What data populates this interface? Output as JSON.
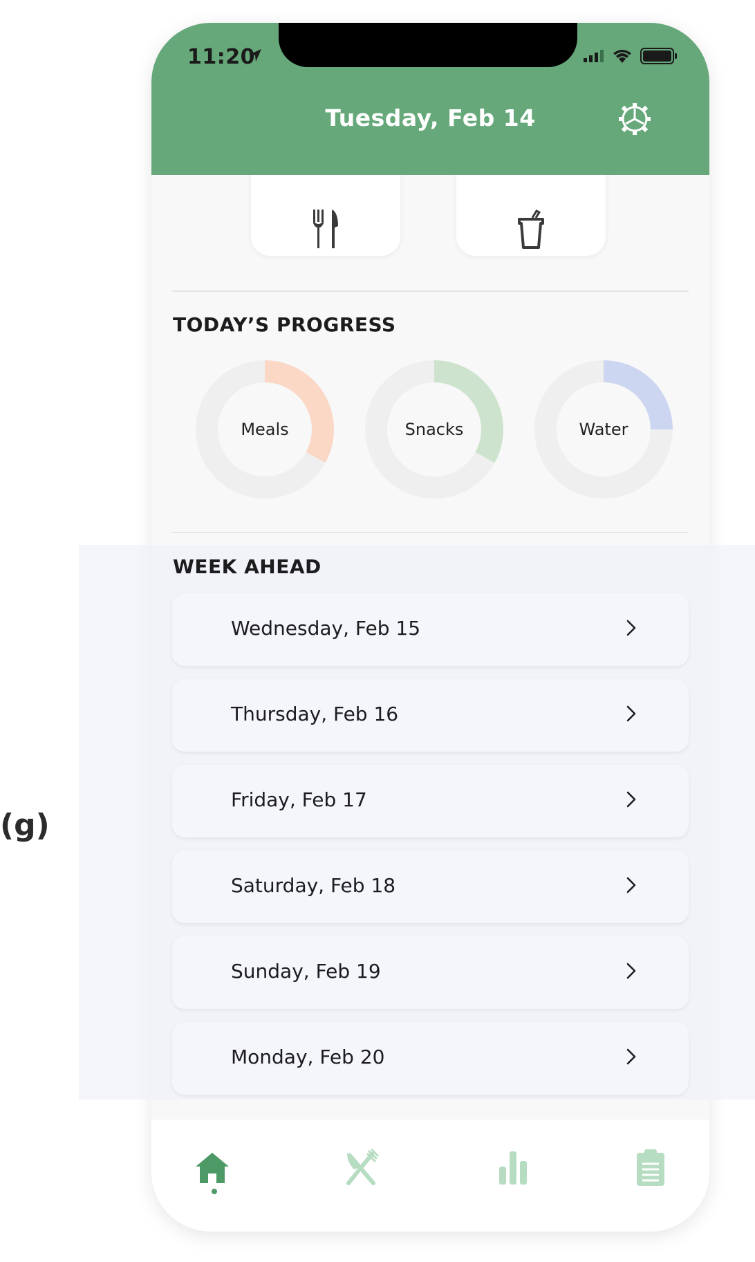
{
  "figure_label": "(g)",
  "status_bar": {
    "time": "11:20"
  },
  "header": {
    "title": "Tuesday, Feb 14"
  },
  "top_cards": [
    {
      "name": "food",
      "icon": "fork-knife-icon"
    },
    {
      "name": "water",
      "icon": "cup-icon"
    }
  ],
  "progress": {
    "title": "TODAY’S PROGRESS",
    "rings": [
      {
        "label": "Meals",
        "fraction": 0.33,
        "color": "#fbd7c6"
      },
      {
        "label": "Snacks",
        "fraction": 0.33,
        "color": "#cde3cd"
      },
      {
        "label": "Water",
        "fraction": 0.25,
        "color": "#cdd6f0"
      }
    ],
    "track_color": "#efefef"
  },
  "week": {
    "title": "WEEK AHEAD",
    "days": [
      {
        "label": "Wednesday, Feb 15"
      },
      {
        "label": "Thursday, Feb 16"
      },
      {
        "label": "Friday, Feb 17"
      },
      {
        "label": "Saturday, Feb 18"
      },
      {
        "label": "Sunday, Feb 19"
      },
      {
        "label": "Monday, Feb 20"
      }
    ]
  },
  "tabbar": {
    "tabs": [
      {
        "name": "home",
        "icon": "home-icon",
        "active": true
      },
      {
        "name": "meals",
        "icon": "utensils-icon",
        "active": false
      },
      {
        "name": "stats",
        "icon": "bar-chart-icon",
        "active": false
      },
      {
        "name": "log",
        "icon": "clipboard-icon",
        "active": false
      }
    ],
    "active_color": "#4e9a66",
    "inactive_color": "#b6dcc2"
  },
  "colors": {
    "header": "#66a87a",
    "background": "#f8f8f8"
  }
}
